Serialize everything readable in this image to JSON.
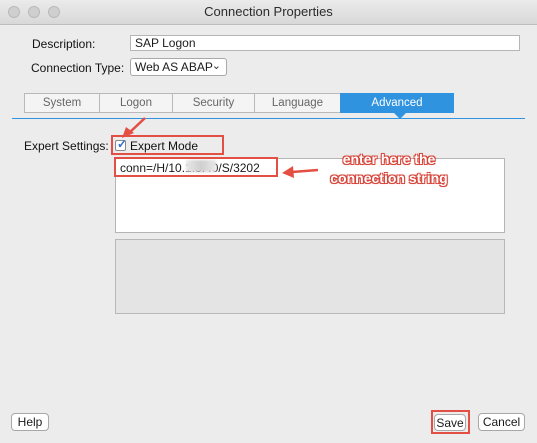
{
  "window": {
    "title": "Connection Properties"
  },
  "form": {
    "description_label": "Description:",
    "description_value": "SAP Logon",
    "connection_type_label": "Connection Type:",
    "connection_type_value": "Web AS ABAP"
  },
  "tabs": [
    {
      "label": "System"
    },
    {
      "label": "Logon"
    },
    {
      "label": "Security"
    },
    {
      "label": "Language"
    },
    {
      "label": "Advanced",
      "active": true
    }
  ],
  "advanced": {
    "expert_settings_label": "Expert Settings:",
    "expert_mode_label": "Expert Mode",
    "expert_mode_checked": true,
    "connection_string": "conn=/H/10.1.3.40/S/3202"
  },
  "annotation": {
    "text": "enter here the connection string"
  },
  "buttons": {
    "help": "Help",
    "save": "Save",
    "cancel": "Cancel"
  },
  "colors": {
    "accent": "#2f93e0",
    "annotation": "#e34f43"
  }
}
